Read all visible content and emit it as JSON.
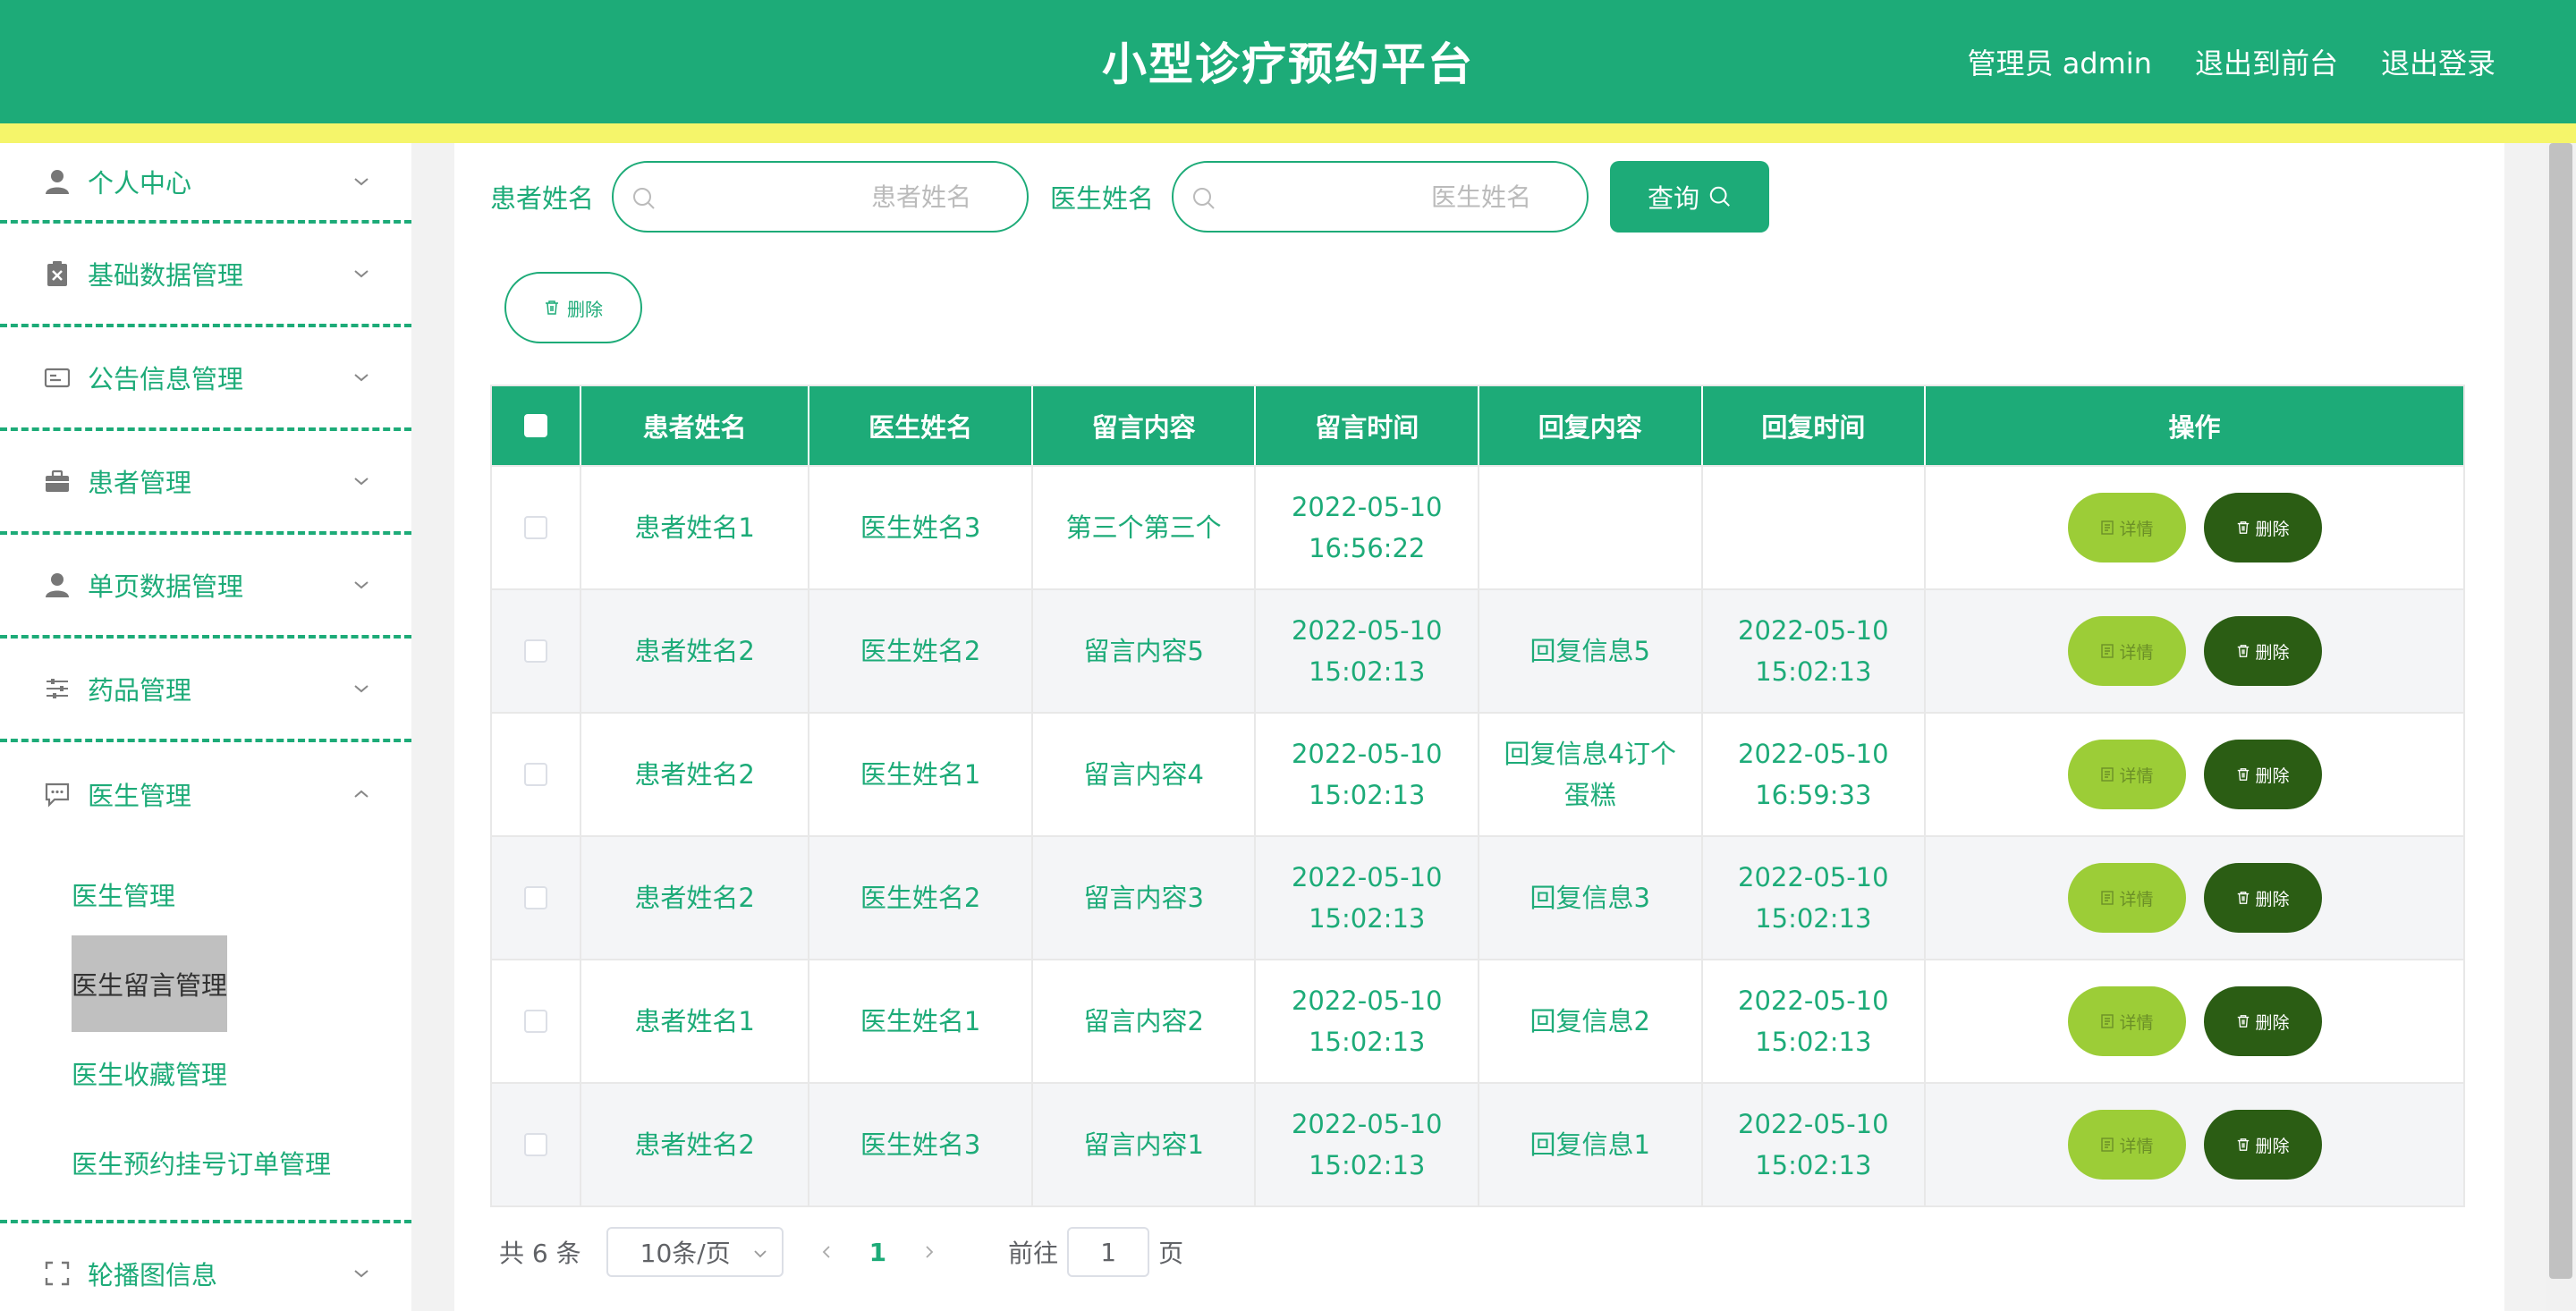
{
  "header": {
    "title": "小型诊疗预约平台",
    "user": "管理员 admin",
    "to_front": "退出到前台",
    "logout": "退出登录"
  },
  "sidebar": {
    "groups": [
      {
        "label": "个人中心",
        "icon": "user-icon"
      },
      {
        "label": "基础数据管理",
        "icon": "clipboard-x-icon"
      },
      {
        "label": "公告信息管理",
        "icon": "id-card-icon"
      },
      {
        "label": "患者管理",
        "icon": "briefcase-icon"
      },
      {
        "label": "单页数据管理",
        "icon": "user-icon"
      },
      {
        "label": "药品管理",
        "icon": "sliders-icon"
      },
      {
        "label": "医生管理",
        "icon": "chat-icon"
      },
      {
        "label": "轮播图信息",
        "icon": "fullscreen-icon"
      }
    ],
    "sub_items": [
      "医生管理",
      "医生留言管理",
      "医生收藏管理",
      "医生预约挂号订单管理"
    ],
    "active_sub": "医生留言管理"
  },
  "search": {
    "patient_label": "患者姓名",
    "patient_placeholder": "患者姓名",
    "doctor_label": "医生姓名",
    "doctor_placeholder": "医生姓名",
    "query_label": "查询"
  },
  "toolbar": {
    "delete_label": "删除"
  },
  "table": {
    "headers": [
      "患者姓名",
      "医生姓名",
      "留言内容",
      "留言时间",
      "回复内容",
      "回复时间",
      "操作"
    ],
    "detail_label": "详情",
    "delete_label": "删除",
    "rows": [
      {
        "patient": "患者姓名1",
        "doctor": "医生姓名3",
        "content": "第三个第三个",
        "time": "2022-05-10 16:56:22",
        "reply": "",
        "reply_time": ""
      },
      {
        "patient": "患者姓名2",
        "doctor": "医生姓名2",
        "content": "留言内容5",
        "time": "2022-05-10 15:02:13",
        "reply": "回复信息5",
        "reply_time": "2022-05-10 15:02:13"
      },
      {
        "patient": "患者姓名2",
        "doctor": "医生姓名1",
        "content": "留言内容4",
        "time": "2022-05-10 15:02:13",
        "reply": "回复信息4订个蛋糕",
        "reply_time": "2022-05-10 16:59:33"
      },
      {
        "patient": "患者姓名2",
        "doctor": "医生姓名2",
        "content": "留言内容3",
        "time": "2022-05-10 15:02:13",
        "reply": "回复信息3",
        "reply_time": "2022-05-10 15:02:13"
      },
      {
        "patient": "患者姓名1",
        "doctor": "医生姓名1",
        "content": "留言内容2",
        "time": "2022-05-10 15:02:13",
        "reply": "回复信息2",
        "reply_time": "2022-05-10 15:02:13"
      },
      {
        "patient": "患者姓名2",
        "doctor": "医生姓名3",
        "content": "留言内容1",
        "time": "2022-05-10 15:02:13",
        "reply": "回复信息1",
        "reply_time": "2022-05-10 15:02:13"
      }
    ]
  },
  "pagination": {
    "total": "共 6 条",
    "page_size": "10条/页",
    "current_page": "1",
    "goto_prefix": "前往",
    "goto_value": "1",
    "goto_suffix": "页"
  },
  "colors": {
    "primary": "#1dab78",
    "accent_yellow": "#f5f56a",
    "detail_button": "#9ccd37",
    "delete_button": "#2b5d14"
  }
}
